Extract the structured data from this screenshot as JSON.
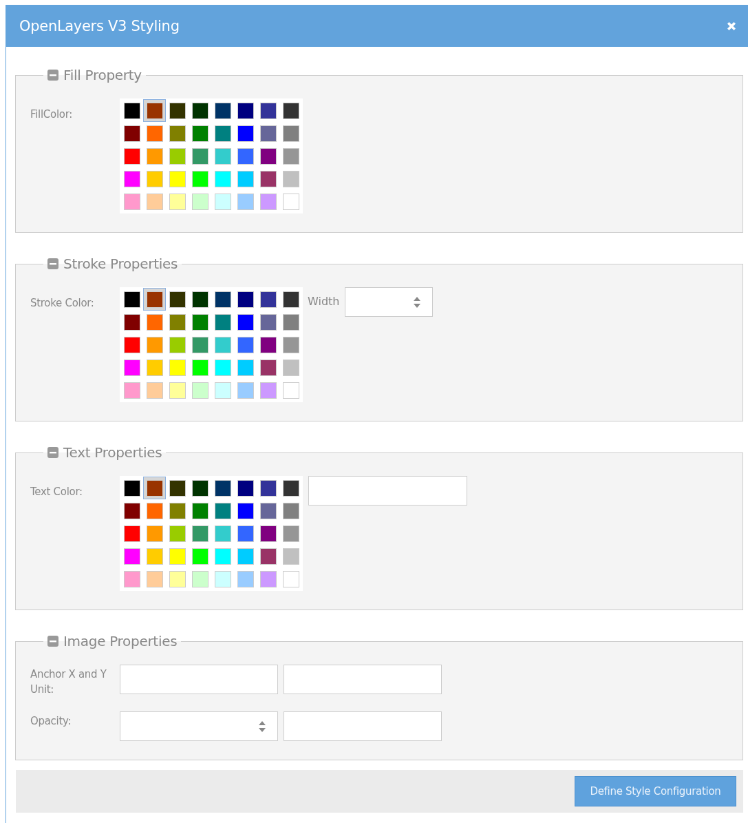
{
  "dialog": {
    "title": "OpenLayers V3 Styling"
  },
  "sections": [
    {
      "legend": "Fill Property",
      "expanded": true,
      "kind": "colors",
      "label": "FillColor:",
      "swatches": [
        {
          "color": "#000000",
          "selected": false
        },
        {
          "color": "#993300",
          "selected": true
        },
        {
          "color": "#333300",
          "selected": false
        },
        {
          "color": "#003300",
          "selected": false
        },
        {
          "color": "#003366",
          "selected": false
        },
        {
          "color": "#000080",
          "selected": false
        },
        {
          "color": "#333399",
          "selected": false
        },
        {
          "color": "#333333",
          "selected": false
        },
        {
          "color": "#800000",
          "selected": false
        },
        {
          "color": "#ff6600",
          "selected": false
        },
        {
          "color": "#808000",
          "selected": false
        },
        {
          "color": "#008000",
          "selected": false
        },
        {
          "color": "#008080",
          "selected": false
        },
        {
          "color": "#0000ff",
          "selected": false
        },
        {
          "color": "#666699",
          "selected": false
        },
        {
          "color": "#808080",
          "selected": false
        },
        {
          "color": "#ff0000",
          "selected": false
        },
        {
          "color": "#ff9900",
          "selected": false
        },
        {
          "color": "#99cc00",
          "selected": false
        },
        {
          "color": "#339966",
          "selected": false
        },
        {
          "color": "#33cccc",
          "selected": false
        },
        {
          "color": "#3366ff",
          "selected": false
        },
        {
          "color": "#800080",
          "selected": false
        },
        {
          "color": "#969696",
          "selected": false
        },
        {
          "color": "#ff00ff",
          "selected": false
        },
        {
          "color": "#ffcc00",
          "selected": false
        },
        {
          "color": "#ffff00",
          "selected": false
        },
        {
          "color": "#00ff00",
          "selected": false
        },
        {
          "color": "#00ffff",
          "selected": false
        },
        {
          "color": "#00ccff",
          "selected": false
        },
        {
          "color": "#993366",
          "selected": false
        },
        {
          "color": "#c0c0c0",
          "selected": false
        },
        {
          "color": "#ff99cc",
          "selected": false
        },
        {
          "color": "#ffcc99",
          "selected": false
        },
        {
          "color": "#ffff99",
          "selected": false
        },
        {
          "color": "#ccffcc",
          "selected": false
        },
        {
          "color": "#ccffff",
          "selected": false
        },
        {
          "color": "#99ccff",
          "selected": false
        },
        {
          "color": "#cc99ff",
          "selected": false
        },
        {
          "color": "#ffffff",
          "selected": false
        }
      ]
    },
    {
      "legend": "Stroke Properties",
      "expanded": true,
      "kind": "colors",
      "label": "Stroke Color:",
      "side_field": {
        "kind": "spinner",
        "label": "Width"
      },
      "swatches": [
        {
          "color": "#000000",
          "selected": false
        },
        {
          "color": "#993300",
          "selected": true
        },
        {
          "color": "#333300",
          "selected": false
        },
        {
          "color": "#003300",
          "selected": false
        },
        {
          "color": "#003366",
          "selected": false
        },
        {
          "color": "#000080",
          "selected": false
        },
        {
          "color": "#333399",
          "selected": false
        },
        {
          "color": "#333333",
          "selected": false
        },
        {
          "color": "#800000",
          "selected": false
        },
        {
          "color": "#ff6600",
          "selected": false
        },
        {
          "color": "#808000",
          "selected": false
        },
        {
          "color": "#008000",
          "selected": false
        },
        {
          "color": "#008080",
          "selected": false
        },
        {
          "color": "#0000ff",
          "selected": false
        },
        {
          "color": "#666699",
          "selected": false
        },
        {
          "color": "#808080",
          "selected": false
        },
        {
          "color": "#ff0000",
          "selected": false
        },
        {
          "color": "#ff9900",
          "selected": false
        },
        {
          "color": "#99cc00",
          "selected": false
        },
        {
          "color": "#339966",
          "selected": false
        },
        {
          "color": "#33cccc",
          "selected": false
        },
        {
          "color": "#3366ff",
          "selected": false
        },
        {
          "color": "#800080",
          "selected": false
        },
        {
          "color": "#969696",
          "selected": false
        },
        {
          "color": "#ff00ff",
          "selected": false
        },
        {
          "color": "#ffcc00",
          "selected": false
        },
        {
          "color": "#ffff00",
          "selected": false
        },
        {
          "color": "#00ff00",
          "selected": false
        },
        {
          "color": "#00ffff",
          "selected": false
        },
        {
          "color": "#00ccff",
          "selected": false
        },
        {
          "color": "#993366",
          "selected": false
        },
        {
          "color": "#c0c0c0",
          "selected": false
        },
        {
          "color": "#ff99cc",
          "selected": false
        },
        {
          "color": "#ffcc99",
          "selected": false
        },
        {
          "color": "#ffff99",
          "selected": false
        },
        {
          "color": "#ccffcc",
          "selected": false
        },
        {
          "color": "#ccffff",
          "selected": false
        },
        {
          "color": "#99ccff",
          "selected": false
        },
        {
          "color": "#cc99ff",
          "selected": false
        },
        {
          "color": "#ffffff",
          "selected": false
        }
      ]
    },
    {
      "legend": "Text Properties",
      "expanded": true,
      "kind": "colors",
      "label": "Text Color:",
      "side_field": {
        "kind": "text"
      },
      "swatches": [
        {
          "color": "#000000",
          "selected": false
        },
        {
          "color": "#993300",
          "selected": true
        },
        {
          "color": "#333300",
          "selected": false
        },
        {
          "color": "#003300",
          "selected": false
        },
        {
          "color": "#003366",
          "selected": false
        },
        {
          "color": "#000080",
          "selected": false
        },
        {
          "color": "#333399",
          "selected": false
        },
        {
          "color": "#333333",
          "selected": false
        },
        {
          "color": "#800000",
          "selected": false
        },
        {
          "color": "#ff6600",
          "selected": false
        },
        {
          "color": "#808000",
          "selected": false
        },
        {
          "color": "#008000",
          "selected": false
        },
        {
          "color": "#008080",
          "selected": false
        },
        {
          "color": "#0000ff",
          "selected": false
        },
        {
          "color": "#666699",
          "selected": false
        },
        {
          "color": "#808080",
          "selected": false
        },
        {
          "color": "#ff0000",
          "selected": false
        },
        {
          "color": "#ff9900",
          "selected": false
        },
        {
          "color": "#99cc00",
          "selected": false
        },
        {
          "color": "#339966",
          "selected": false
        },
        {
          "color": "#33cccc",
          "selected": false
        },
        {
          "color": "#3366ff",
          "selected": false
        },
        {
          "color": "#800080",
          "selected": false
        },
        {
          "color": "#969696",
          "selected": false
        },
        {
          "color": "#ff00ff",
          "selected": false
        },
        {
          "color": "#ffcc00",
          "selected": false
        },
        {
          "color": "#ffff00",
          "selected": false
        },
        {
          "color": "#00ff00",
          "selected": false
        },
        {
          "color": "#00ffff",
          "selected": false
        },
        {
          "color": "#00ccff",
          "selected": false
        },
        {
          "color": "#993366",
          "selected": false
        },
        {
          "color": "#c0c0c0",
          "selected": false
        },
        {
          "color": "#ff99cc",
          "selected": false
        },
        {
          "color": "#ffcc99",
          "selected": false
        },
        {
          "color": "#ffff99",
          "selected": false
        },
        {
          "color": "#ccffcc",
          "selected": false
        },
        {
          "color": "#ccffff",
          "selected": false
        },
        {
          "color": "#99ccff",
          "selected": false
        },
        {
          "color": "#cc99ff",
          "selected": false
        },
        {
          "color": "#ffffff",
          "selected": false
        }
      ]
    },
    {
      "legend": "Image Properties",
      "expanded": true,
      "kind": "fields",
      "rows": [
        {
          "label": "Anchor X and Y Unit:",
          "fields": [
            {
              "kind": "text"
            },
            {
              "kind": "text"
            }
          ]
        },
        {
          "label": "Opacity:",
          "fields": [
            {
              "kind": "spinner"
            },
            {
              "kind": "text"
            }
          ]
        }
      ]
    }
  ],
  "footer": {
    "button": "Define Style Configuration"
  }
}
